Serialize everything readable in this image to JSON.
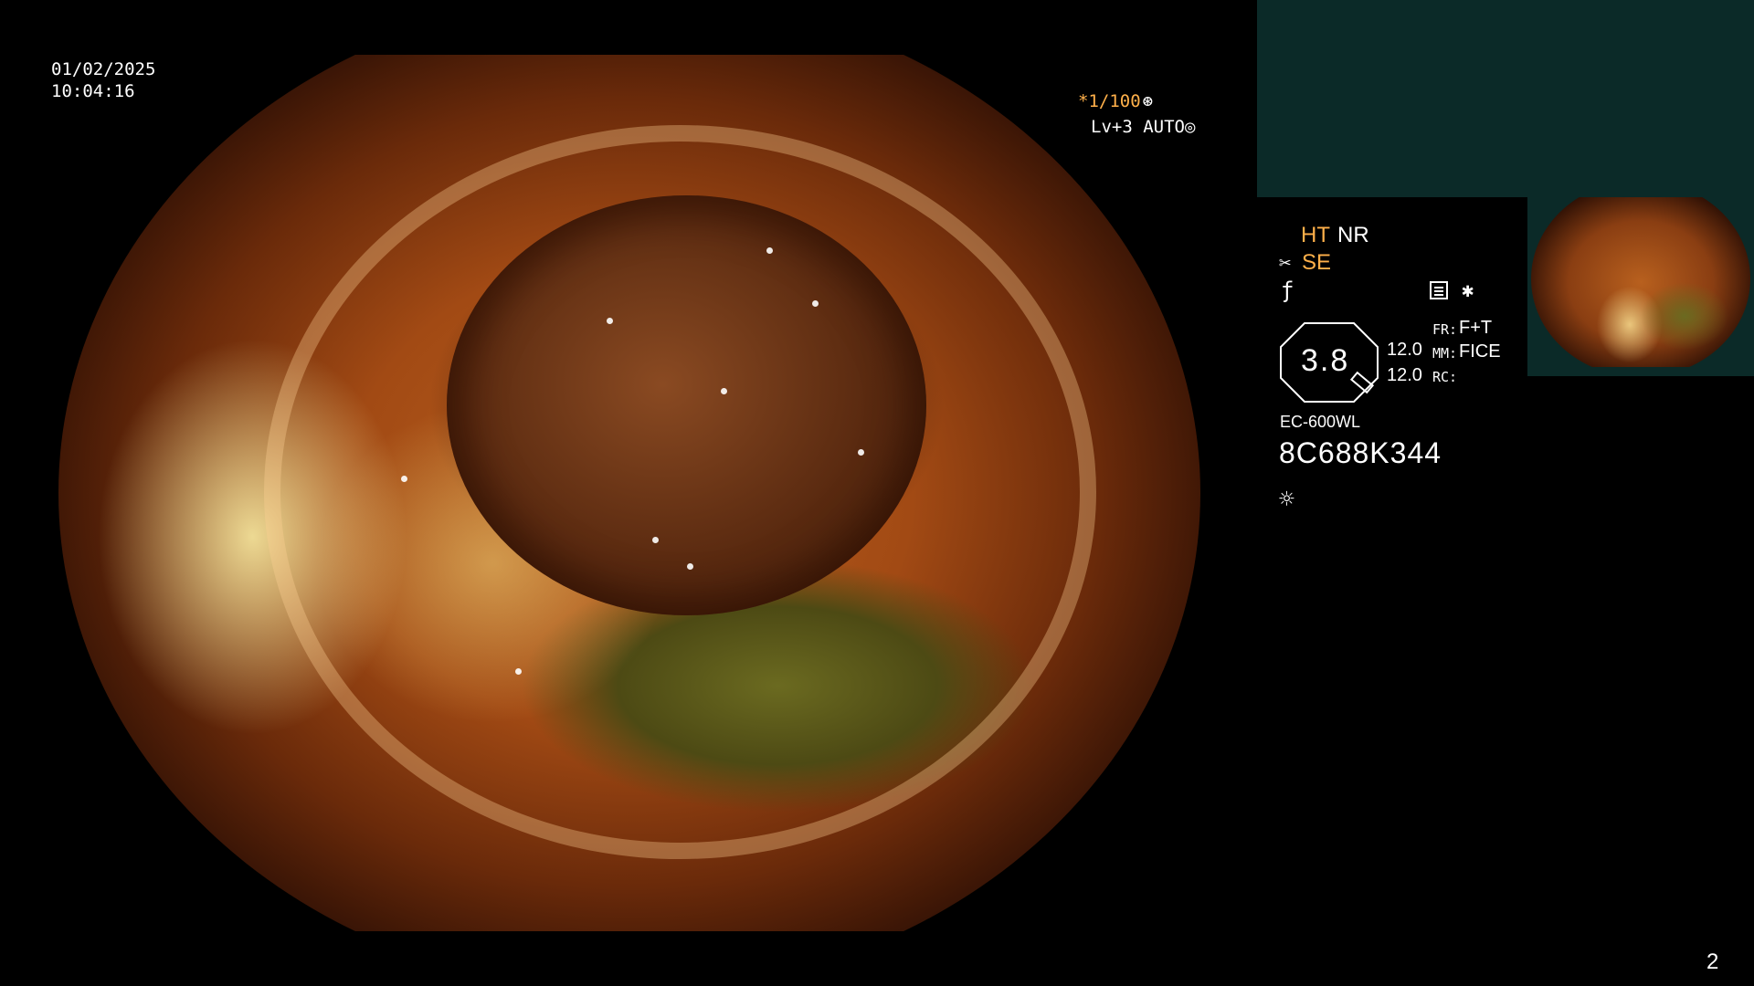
{
  "overlay": {
    "date": "01/02/2025",
    "time": "10:04:16",
    "shutter": "*1/100",
    "level": "Lv+3 AUTO",
    "ht": "HT",
    "nr": "NR",
    "se": "SE",
    "zoom_value": "3.8",
    "value_a": "12.0",
    "value_b": "12.0",
    "fr_label": "FR:",
    "fr_value": "F+T",
    "mm_label": "MM:",
    "mm_value": "FICE",
    "rc_label": "RC:",
    "scope_model": "EC-600WL",
    "serial": "8C688K344",
    "page_number": "2"
  },
  "icons": [
    "shutter-mode-icon",
    "auto-iris-icon",
    "scissors-icon",
    "f-icon",
    "image-mode-icon",
    "star-icon",
    "light-icon"
  ],
  "colors": {
    "accent": "#ffb04a",
    "thumb_bg": "#0b2a28"
  }
}
